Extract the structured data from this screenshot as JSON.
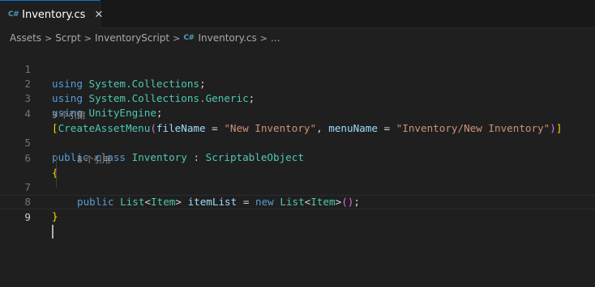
{
  "tab": {
    "title": "Inventory.cs",
    "icon": "C#",
    "close": "✕"
  },
  "breadcrumb": {
    "items": [
      "Assets",
      "Scrpt",
      "InventoryScript"
    ],
    "file_icon": "C#",
    "file": "Inventory.cs",
    "more": "...",
    "separator": ">"
  },
  "editor": {
    "line_numbers": [
      "1",
      "2",
      "3",
      "4",
      "5",
      "6",
      "7",
      "8",
      "9"
    ],
    "codelens": {
      "class_refs": "3 个引用",
      "field_refs": "8 个引用"
    },
    "lines": {
      "l1": {
        "kw": "using",
        "ns": "System.Collections",
        "end": ";"
      },
      "l2": {
        "kw": "using",
        "ns": "System.Collections.Generic",
        "end": ";"
      },
      "l3": {
        "kw": "using",
        "ns": "UnityEngine",
        "end": ";"
      },
      "l4": {
        "open": "[",
        "attr": "CreateAssetMenu",
        "paren_open": "(",
        "p1": "fileName",
        "eq1": " = ",
        "s1": "\"New Inventory\"",
        "comma": ", ",
        "p2": "menuName",
        "eq2": " = ",
        "s2": "\"Inventory/New Inventory\"",
        "paren_close": ")",
        "close": "]"
      },
      "l5": {
        "kw1": "public",
        "kw2": "class",
        "name": "Inventory",
        "colon": " : ",
        "base": "ScriptableObject"
      },
      "l6": {
        "brace": "{"
      },
      "l7": {
        "kw": "public",
        "type1": "List",
        "lt1": "<",
        "item1": "Item",
        "gt1": ">",
        "field": "itemList",
        "eq": " = ",
        "new": "new",
        "type2": "List",
        "lt2": "<",
        "item2": "Item",
        "gt2": ">",
        "parens": "()",
        "end": ";"
      },
      "l8": {
        "brace": "}"
      }
    }
  },
  "colors": {
    "background": "#1f1f1f",
    "keyword": "#569cd6",
    "type": "#4ec9b0",
    "function": "#dcdcaa",
    "variable": "#9cdcfe",
    "string": "#ce9178",
    "bracket_level1": "#ffd700",
    "bracket_level2": "#da70d6",
    "tab_accent": "#0078d4"
  }
}
